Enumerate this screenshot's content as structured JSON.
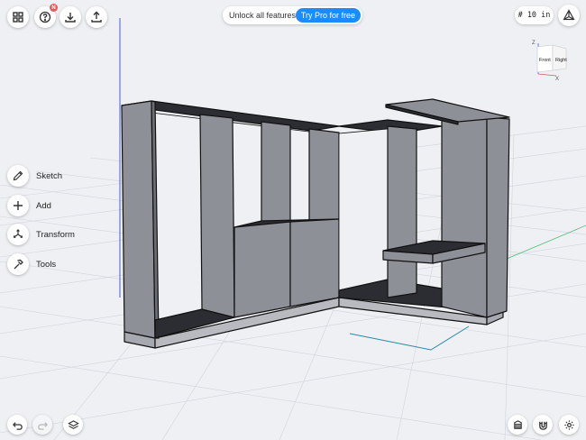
{
  "toolbar": {
    "icons": [
      "grid-menu-icon",
      "help-icon",
      "download-icon",
      "share-icon"
    ],
    "notification_badge": "N"
  },
  "promo": {
    "text": "Unlock all features",
    "button_label": "Try Pro for free",
    "button_color": "#1a8cff"
  },
  "grid_setting": {
    "label": "# 10 in"
  },
  "view_cube": {
    "front_label": "Front",
    "right_label": "Right",
    "axis_z": "Z",
    "axis_x": "X"
  },
  "tools": [
    {
      "label": "Sketch",
      "icon": "pencil-icon"
    },
    {
      "label": "Add",
      "icon": "plus-icon"
    },
    {
      "label": "Transform",
      "icon": "transform-icon"
    },
    {
      "label": "Tools",
      "icon": "hammer-icon"
    }
  ],
  "bottom_bar": {
    "left": [
      "undo-icon",
      "redo-icon",
      "layers-icon"
    ],
    "right": [
      "material-icon",
      "snap-magnet-icon",
      "settings-gear-icon"
    ]
  },
  "colors": {
    "background": "#eef0f4",
    "panel_face": "#8e9098",
    "panel_top": "#2c2d33",
    "grid_line": "#cfd3da",
    "axis_blue": "#4a5bd8",
    "axis_green": "#4bbf7a"
  }
}
